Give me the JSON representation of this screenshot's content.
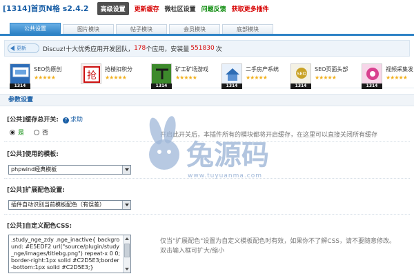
{
  "header": {
    "title": "[1314]首页N格 s2.4.2",
    "nav": [
      {
        "label": "高级设置",
        "style": "active"
      },
      {
        "label": "更新缓存",
        "style": "red"
      },
      {
        "label": "微社区设置",
        "style": "dark"
      },
      {
        "label": "问题反馈",
        "style": "green"
      },
      {
        "label": "获取更多插件",
        "style": "red"
      }
    ]
  },
  "tabs": [
    "公共设置",
    "图片模块",
    "帖子模块",
    "会员模块",
    "底部模块"
  ],
  "info": {
    "badge": "更新",
    "prefix": "Discuz!十大优秀应用开发团队，",
    "app_count": "178",
    "middle": "个应用，安装量",
    "install_count": "551830",
    "suffix": "次"
  },
  "plugins": [
    {
      "name": "SEO伪原创",
      "stars": "★★★★★",
      "version": "1314",
      "icon": "seo-screen-icon"
    },
    {
      "name": "抢楼扣积分",
      "stars": "★★★★★",
      "version": "",
      "icon": "grab-floor-icon"
    },
    {
      "name": "矿工矿场游戏",
      "stars": "★★★★★",
      "version": "1314",
      "icon": "pickaxe-icon"
    },
    {
      "name": "二手房产系统",
      "stars": "★★★★★",
      "version": "1314",
      "icon": "house-icon"
    },
    {
      "name": "SEO页面头部",
      "stars": "★★★★★",
      "version": "1314",
      "icon": "seo-head-icon"
    },
    {
      "name": "视频采集发",
      "stars": "★★★★★",
      "version": "1314",
      "icon": "video-icon"
    }
  ],
  "section": {
    "title": "参数设置"
  },
  "cache_setting": {
    "label": "[公共]缓存总开关:",
    "help": "求助",
    "option_yes": "是",
    "option_no": "否",
    "desc": "开启此开关后，本插件所有的模块都将开启缓存，在这里可以直接关闭所有缓存"
  },
  "template_setting": {
    "label": "[公共]使用的模板:",
    "value": "phpwind经典模板"
  },
  "color_setting": {
    "label": "[公共]扩展配色设置:",
    "value": "插件自动识别当前模板配色（有误差）"
  },
  "css_setting": {
    "label": "[公共]自定义配色CSS:",
    "value": ".study_nge_zdy .nge_inactive{ background: #E5EDF2 url(\"source/plugin/study_nge/images/titlebg.png\") repeat-x 0 0; border-right:1px solid #C2D5E3;border-bottom:1px solid #C2D5E3;}",
    "desc_line1": "仅当\"扩展配色\"设置为自定义模板配色时有效，如果你不了解CSS，请不要随意修改。",
    "desc_line2": "双击输入框可扩大/缩小"
  },
  "watermark": {
    "text": "www.tuyuanma.com",
    "logo": "兔源码"
  },
  "colors": {
    "brand_blue": "#2e83c6",
    "link_blue": "#1a5fa6",
    "red": "#d60000",
    "star": "#f2b01e"
  }
}
